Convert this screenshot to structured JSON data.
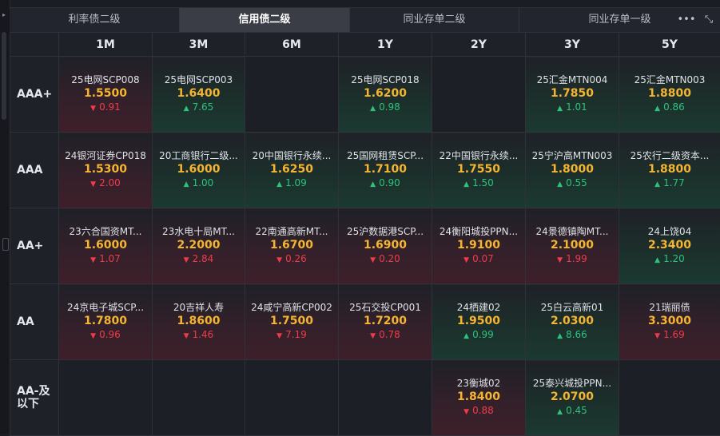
{
  "tabs": [
    {
      "label": "利率债二级",
      "active": false
    },
    {
      "label": "信用债二级",
      "active": true
    },
    {
      "label": "同业存单二级",
      "active": false
    },
    {
      "label": "同业存单一级",
      "active": false
    }
  ],
  "tools": {
    "more": "•••",
    "expand": "⤡"
  },
  "columns": [
    "1M",
    "3M",
    "6M",
    "1Y",
    "2Y",
    "3Y",
    "5Y"
  ],
  "rows": [
    {
      "rating": "AAA+",
      "cells": [
        {
          "name": "25电网SCP008",
          "rate": "1.5500",
          "change": "0.91",
          "dir": "down"
        },
        {
          "name": "25电网SCP003",
          "rate": "1.6400",
          "change": "7.65",
          "dir": "up"
        },
        null,
        {
          "name": "25电网SCP018",
          "rate": "1.6200",
          "change": "0.98",
          "dir": "up"
        },
        null,
        {
          "name": "25汇金MTN004",
          "rate": "1.7850",
          "change": "1.01",
          "dir": "up"
        },
        {
          "name": "25汇金MTN003",
          "rate": "1.8800",
          "change": "0.86",
          "dir": "up"
        }
      ]
    },
    {
      "rating": "AAA",
      "cells": [
        {
          "name": "24银河证券CP018",
          "rate": "1.5300",
          "change": "2.00",
          "dir": "down"
        },
        {
          "name": "20工商银行二级...",
          "rate": "1.6000",
          "change": "1.00",
          "dir": "up"
        },
        {
          "name": "20中国银行永续...",
          "rate": "1.6250",
          "change": "1.09",
          "dir": "up"
        },
        {
          "name": "25国网租赁SCP...",
          "rate": "1.7100",
          "change": "0.90",
          "dir": "up"
        },
        {
          "name": "22中国银行永续...",
          "rate": "1.7550",
          "change": "1.50",
          "dir": "up"
        },
        {
          "name": "25宁沪高MTN003",
          "rate": "1.8000",
          "change": "0.55",
          "dir": "up"
        },
        {
          "name": "25农行二级资本...",
          "rate": "1.8800",
          "change": "1.77",
          "dir": "up"
        }
      ]
    },
    {
      "rating": "AA+",
      "cells": [
        {
          "name": "23六合国资MT...",
          "rate": "1.6000",
          "change": "1.07",
          "dir": "down"
        },
        {
          "name": "23水电十局MT...",
          "rate": "2.2000",
          "change": "2.84",
          "dir": "down"
        },
        {
          "name": "22南通高新MT...",
          "rate": "1.6700",
          "change": "0.26",
          "dir": "down"
        },
        {
          "name": "25沪数据港SCP...",
          "rate": "1.6900",
          "change": "0.20",
          "dir": "down"
        },
        {
          "name": "24衡阳城投PPN...",
          "rate": "1.9100",
          "change": "0.07",
          "dir": "down"
        },
        {
          "name": "24景德镇陶MT...",
          "rate": "2.1000",
          "change": "1.99",
          "dir": "down"
        },
        {
          "name": "24上饶04",
          "rate": "2.3400",
          "change": "1.20",
          "dir": "up"
        }
      ]
    },
    {
      "rating": "AA",
      "cells": [
        {
          "name": "24京电子城SCP...",
          "rate": "1.7800",
          "change": "0.96",
          "dir": "down"
        },
        {
          "name": "20吉祥人寿",
          "rate": "1.8600",
          "change": "1.46",
          "dir": "down"
        },
        {
          "name": "24咸宁高新CP002",
          "rate": "1.7500",
          "change": "7.19",
          "dir": "down"
        },
        {
          "name": "25石交投CP001",
          "rate": "1.7200",
          "change": "0.78",
          "dir": "down"
        },
        {
          "name": "24栖建02",
          "rate": "1.9500",
          "change": "0.99",
          "dir": "up"
        },
        {
          "name": "25白云高新01",
          "rate": "2.0300",
          "change": "8.66",
          "dir": "up"
        },
        {
          "name": "21瑞丽债",
          "rate": "3.3000",
          "change": "1.69",
          "dir": "down"
        }
      ]
    },
    {
      "rating": "AA-及以下",
      "cells": [
        null,
        null,
        null,
        null,
        {
          "name": "23衡城02",
          "rate": "1.8400",
          "change": "0.88",
          "dir": "down"
        },
        {
          "name": "25泰兴城投PPN...",
          "rate": "2.0700",
          "change": "0.45",
          "dir": "up"
        },
        null
      ]
    }
  ],
  "colors": {
    "up": "#2fc27f",
    "down": "#f03b4a",
    "rate": "#f5b531"
  }
}
